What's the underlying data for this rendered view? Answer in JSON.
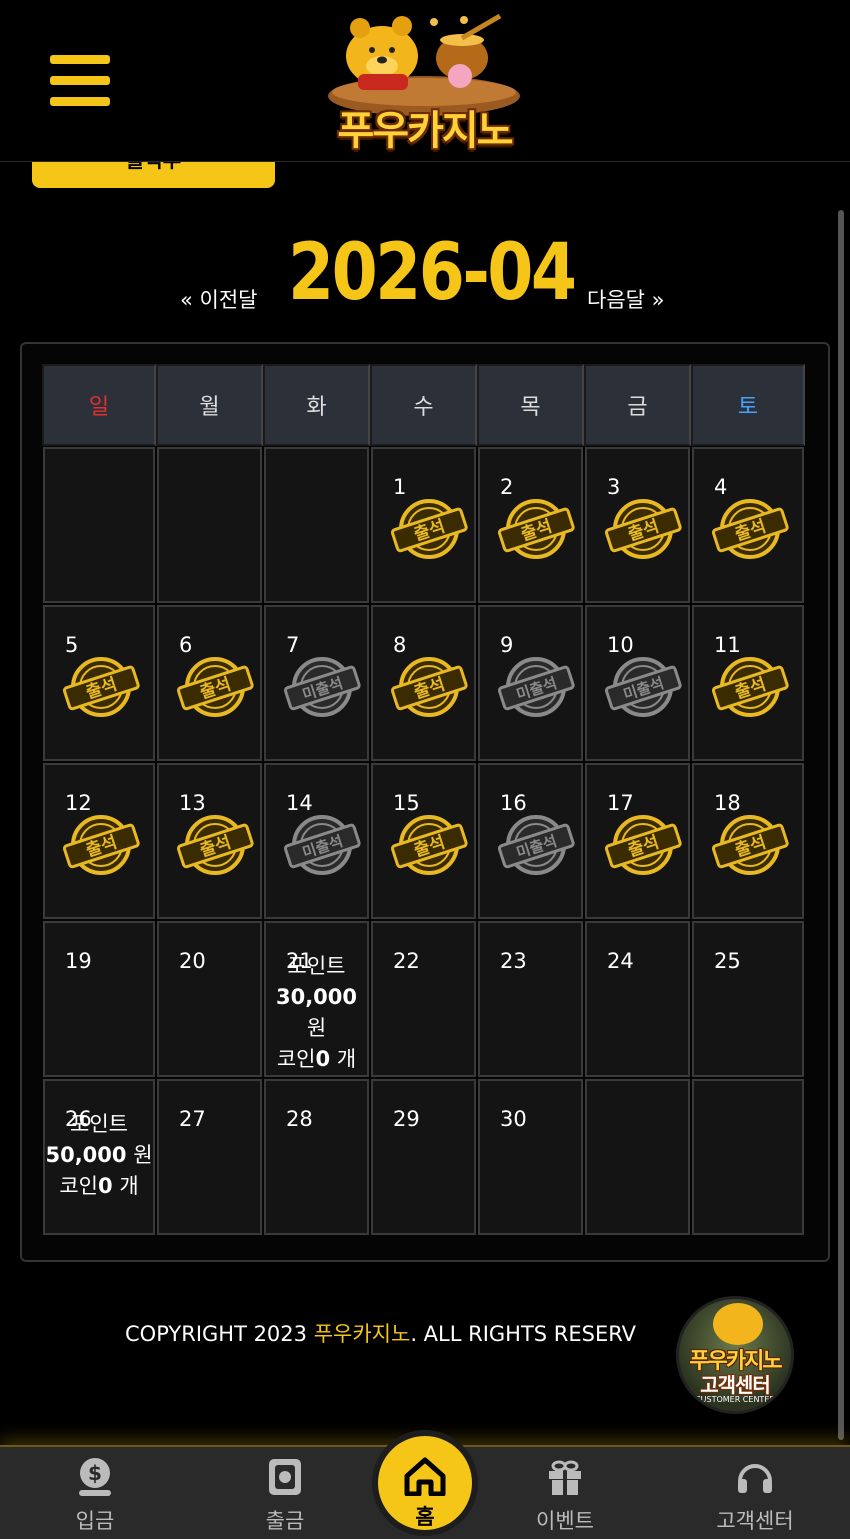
{
  "header": {
    "logo_text": "푸우카지노",
    "menu_icon": "hamburger-menu-icon",
    "top_button_label": "출석부"
  },
  "calendar": {
    "prev_label": "« 이전달",
    "next_label": "다음달 »",
    "month": "2026-04",
    "weekdays": [
      "일",
      "월",
      "화",
      "수",
      "목",
      "금",
      "토"
    ],
    "stamp_attended": "출석",
    "stamp_missed": "미출석",
    "points_label": "포인트",
    "won_unit": "원",
    "coin_label": "코인",
    "coin_unit": "개",
    "weeks": [
      [
        {
          "day": "",
          "status": "none"
        },
        {
          "day": "",
          "status": "none"
        },
        {
          "day": "",
          "status": "none"
        },
        {
          "day": "1",
          "status": "attended"
        },
        {
          "day": "2",
          "status": "attended"
        },
        {
          "day": "3",
          "status": "attended"
        },
        {
          "day": "4",
          "status": "attended"
        }
      ],
      [
        {
          "day": "5",
          "status": "attended"
        },
        {
          "day": "6",
          "status": "attended"
        },
        {
          "day": "7",
          "status": "missed"
        },
        {
          "day": "8",
          "status": "attended"
        },
        {
          "day": "9",
          "status": "missed"
        },
        {
          "day": "10",
          "status": "missed"
        },
        {
          "day": "11",
          "status": "attended"
        }
      ],
      [
        {
          "day": "12",
          "status": "attended"
        },
        {
          "day": "13",
          "status": "attended"
        },
        {
          "day": "14",
          "status": "missed"
        },
        {
          "day": "15",
          "status": "attended"
        },
        {
          "day": "16",
          "status": "missed"
        },
        {
          "day": "17",
          "status": "attended"
        },
        {
          "day": "18",
          "status": "attended"
        }
      ],
      [
        {
          "day": "19",
          "status": "none"
        },
        {
          "day": "20",
          "status": "none"
        },
        {
          "day": "21",
          "status": "reward",
          "points": "30,000",
          "coins": "0"
        },
        {
          "day": "22",
          "status": "none"
        },
        {
          "day": "23",
          "status": "none"
        },
        {
          "day": "24",
          "status": "none"
        },
        {
          "day": "25",
          "status": "none"
        }
      ],
      [
        {
          "day": "26",
          "status": "reward",
          "points": "50,000",
          "coins": "0"
        },
        {
          "day": "27",
          "status": "none"
        },
        {
          "day": "28",
          "status": "none"
        },
        {
          "day": "29",
          "status": "none"
        },
        {
          "day": "30",
          "status": "none"
        },
        {
          "day": "",
          "status": "none"
        },
        {
          "day": "",
          "status": "none"
        }
      ]
    ]
  },
  "footer": {
    "copyright_prefix": "COPYRIGHT 2023 ",
    "copyright_brand": "푸우카지노",
    "copyright_suffix": ". ALL RIGHTS RESERV",
    "cs_badge_title": "푸우카지노",
    "cs_badge_sub": "고객센터",
    "cs_badge_en": "CUSTOMER CENTER"
  },
  "bottom_nav": {
    "items": [
      {
        "label": "입금",
        "icon": "deposit-icon"
      },
      {
        "label": "출금",
        "icon": "withdraw-icon"
      },
      {
        "label": "홈",
        "icon": "home-icon"
      },
      {
        "label": "이벤트",
        "icon": "gift-icon"
      },
      {
        "label": "고객센터",
        "icon": "headset-icon"
      }
    ]
  },
  "colors": {
    "accent": "#f5c518",
    "sunday": "#e03030",
    "saturday": "#4aa0ff",
    "background": "#000000"
  }
}
